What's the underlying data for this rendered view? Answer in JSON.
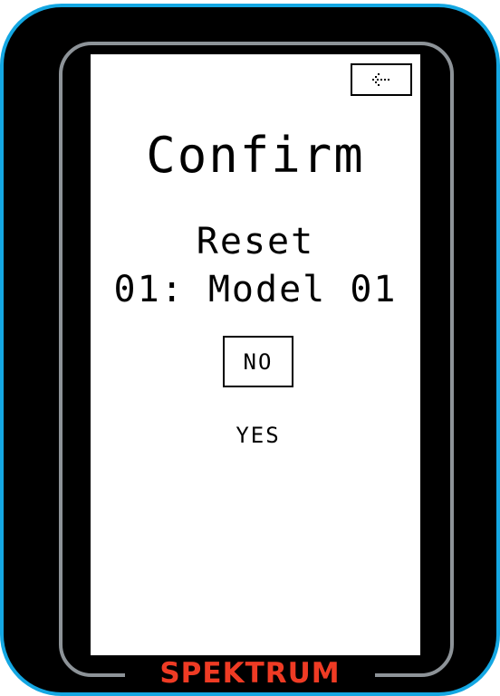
{
  "screen": {
    "back_icon": "back-arrow-icon",
    "title": "Confirm",
    "message_line1": "Reset",
    "message_line2": "01: Model 01",
    "options": {
      "no_label": "NO",
      "yes_label": "YES",
      "selected": "NO"
    }
  },
  "device": {
    "brand": "SPEKTRUM",
    "colors": {
      "bezel": "#000000",
      "accent": "#14A7E2",
      "brand": "#EF3B24",
      "screen": "#FFFFFF"
    }
  }
}
